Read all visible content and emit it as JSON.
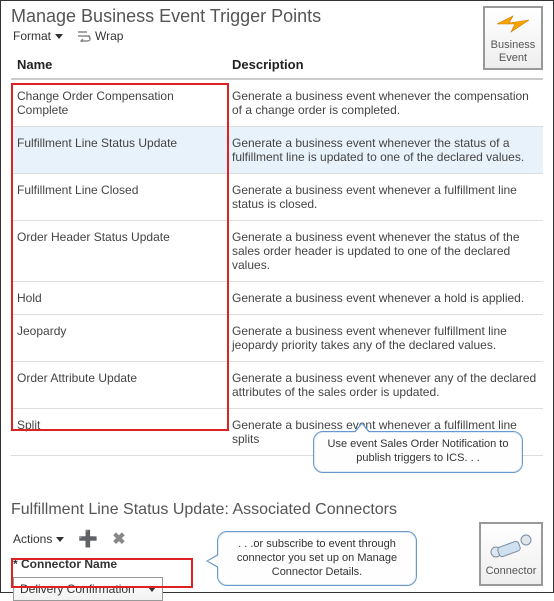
{
  "header": {
    "title": "Manage Business Event Trigger Points",
    "format_label": "Format",
    "wrap_label": "Wrap",
    "badge_label": "Business Event"
  },
  "table": {
    "col_name": "Name",
    "col_desc": "Description",
    "rows": [
      {
        "name": "Change Order Compensation Complete",
        "desc": "Generate a business event whenever the compensation of a change order is completed.",
        "highlight": false
      },
      {
        "name": "Fulfillment Line Status Update",
        "desc": "Generate a business event whenever the status of a fulfillment line is updated to one of the declared values.",
        "highlight": true
      },
      {
        "name": "Fulfillment Line Closed",
        "desc": "Generate a business event whenever a fulfillment line status is closed.",
        "highlight": false
      },
      {
        "name": "Order Header Status Update",
        "desc": "Generate a business event whenever the status of the sales order header is updated to one of the declared values.",
        "highlight": false
      },
      {
        "name": "Hold",
        "desc": "Generate a business event whenever a hold is applied.",
        "highlight": false
      },
      {
        "name": "Jeopardy",
        "desc": "Generate a business event whenever fulfillment line jeopardy priority takes any of the declared values.",
        "highlight": false
      },
      {
        "name": "Order Attribute Update",
        "desc": "Generate a business event whenever any of the declared attributes of the sales order is updated.",
        "highlight": false
      },
      {
        "name": "Split",
        "desc": "Generate a business event whenever a fulfillment line splits",
        "highlight": false
      }
    ]
  },
  "callouts": {
    "c1": "Use event Sales Order Notification to publish triggers to ICS. . .",
    "c2": ". . .or subscribe to event through connector you set up on Manage Connector Details."
  },
  "section2": {
    "title": "Fulfillment Line Status Update: Associated Connectors",
    "actions_label": "Actions",
    "connector_name_label": "Connector Name",
    "connector_selected": "Delivery Confirmation",
    "badge2_label": "Connector"
  }
}
